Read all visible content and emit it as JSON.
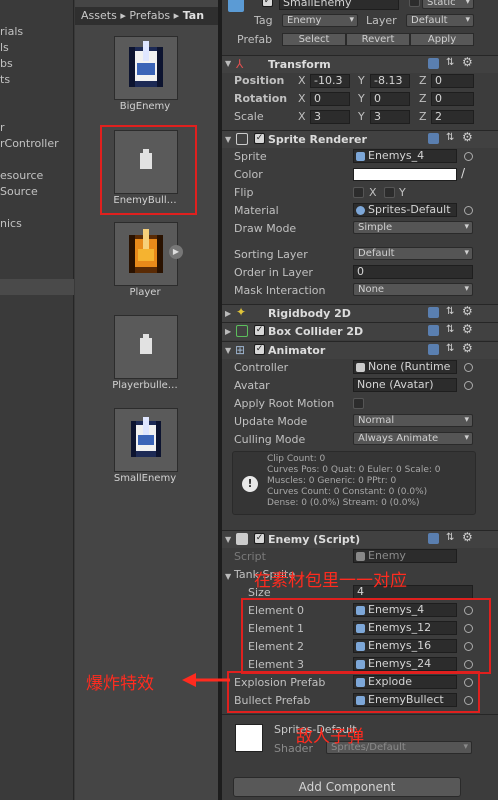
{
  "left_panel": {
    "items": [
      "rials",
      "ls",
      "bs",
      "ts",
      "r",
      "rController",
      "esource",
      "Source",
      "nics"
    ]
  },
  "project": {
    "breadcrumb": [
      "Assets",
      "Prefabs",
      "Tan"
    ],
    "assets": [
      {
        "label": "BigEnemy",
        "icon": "tank-sprite-icon"
      },
      {
        "label": "EnemyBull…",
        "icon": "bullet-sprite-icon"
      },
      {
        "label": "Player",
        "icon": "tank-sprite-icon"
      },
      {
        "label": "Playerbulle…",
        "icon": "bullet-sprite-icon"
      },
      {
        "label": "SmallEnemy",
        "icon": "tank-sprite-icon"
      }
    ]
  },
  "inspector": {
    "object_name": "SmallEnemy",
    "static_label": "Static",
    "tag_label": "Tag",
    "tag_value": "Enemy",
    "layer_label": "Layer",
    "layer_value": "Default",
    "prefab_label": "Prefab",
    "select": "Select",
    "revert": "Revert",
    "apply": "Apply",
    "transform": {
      "title": "Transform",
      "position": {
        "label": "Position",
        "x": "-10.3",
        "y": "-8.13",
        "z": "0"
      },
      "rotation": {
        "label": "Rotation",
        "x": "0",
        "y": "0",
        "z": "0"
      },
      "scale": {
        "label": "Scale",
        "x": "3",
        "y": "3",
        "z": "2"
      }
    },
    "sprite_renderer": {
      "title": "Sprite Renderer",
      "sprite_label": "Sprite",
      "sprite": "Enemys_4",
      "color_label": "Color",
      "flip_label": "Flip",
      "flip_x": "X",
      "flip_y": "Y",
      "material_label": "Material",
      "material": "Sprites-Default",
      "draw_mode_label": "Draw Mode",
      "draw_mode": "Simple",
      "sorting_layer_label": "Sorting Layer",
      "sorting_layer": "Default",
      "order_label": "Order in Layer",
      "order": "0",
      "mask_label": "Mask Interaction",
      "mask": "None"
    },
    "rigidbody": {
      "title": "Rigidbody 2D"
    },
    "box_collider": {
      "title": "Box Collider 2D"
    },
    "animator": {
      "title": "Animator",
      "controller_label": "Controller",
      "controller": "None (Runtime",
      "avatar_label": "Avatar",
      "avatar": "None (Avatar)",
      "root_motion_label": "Apply Root Motion",
      "update_mode_label": "Update Mode",
      "update_mode": "Normal",
      "culling_label": "Culling Mode",
      "culling": "Always Animate",
      "info": [
        "Clip Count: 0",
        "Curves Pos: 0 Quat: 0 Euler: 0 Scale: 0",
        "Muscles: 0 Generic: 0 PPtr: 0",
        "Curves Count: 0 Constant: 0 (0.0%)",
        "Dense: 0 (0.0%) Stream: 0 (0.0%)"
      ]
    },
    "enemy_script": {
      "title": "Enemy (Script)",
      "script_label": "Script",
      "script": "Enemy",
      "tank_sprite_label": "Tank Sprite",
      "size_label": "Size",
      "size": "4",
      "elements": [
        {
          "label": "Element 0",
          "value": "Enemys_4"
        },
        {
          "label": "Element 1",
          "value": "Enemys_12"
        },
        {
          "label": "Element 2",
          "value": "Enemys_16"
        },
        {
          "label": "Element 3",
          "value": "Enemys_24"
        }
      ],
      "explosion_label": "Explosion Prefab",
      "explosion": "Explode",
      "bullet_label": "Bullect Prefab",
      "bullet": "EnemyBullect"
    },
    "material_footer": {
      "name": "Sprites-Default",
      "shader_label": "Shader",
      "shader": "Sprites/Default"
    },
    "add_component": "Add Component"
  },
  "annotations": {
    "top": "在素材包里一一对应",
    "left": "爆炸特效",
    "bottom": "敌人子弹"
  },
  "colors": {
    "annotation_red": "#ff2b1f",
    "panel_bg": "#3c3c3c"
  }
}
